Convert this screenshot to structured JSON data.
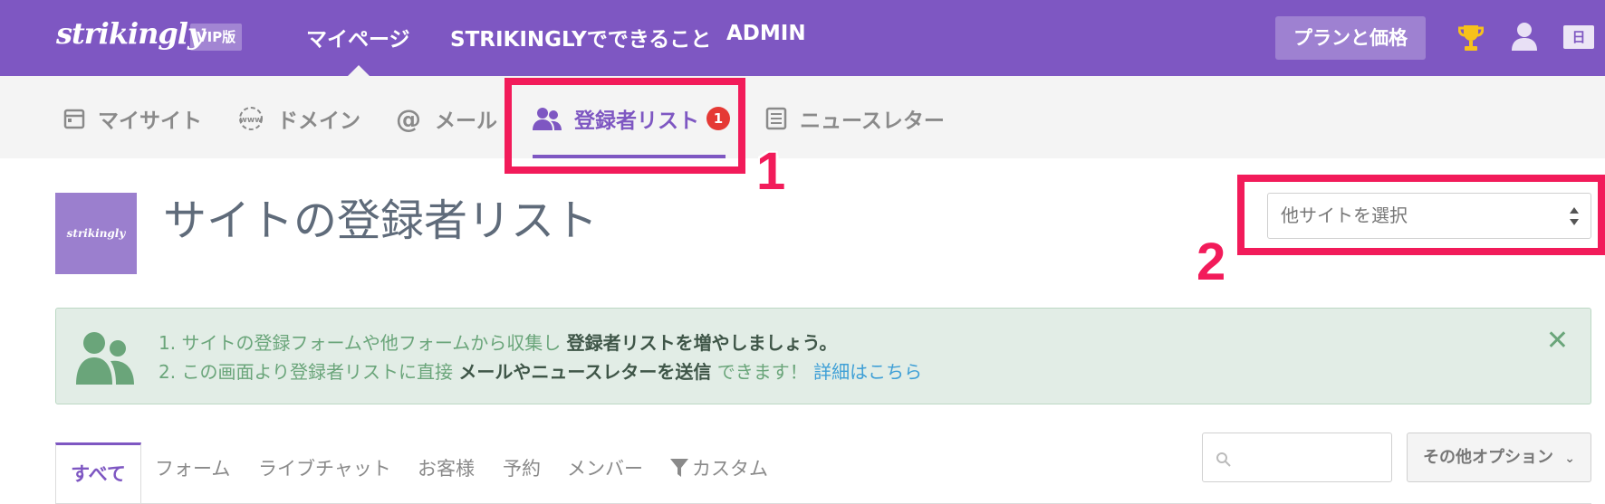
{
  "topbar": {
    "logo": "strikingly",
    "vip_badge": "VIP版",
    "nav": [
      {
        "label": "マイページ"
      },
      {
        "label": "STRIKINGLYでできること"
      },
      {
        "label": "ADMIN"
      }
    ],
    "plan_button": "プランと価格",
    "lang_button": "日"
  },
  "subnav": {
    "items": [
      {
        "label": "マイサイト",
        "icon": "calendar-icon"
      },
      {
        "label": "ドメイン",
        "icon": "www-icon"
      },
      {
        "label": "メール",
        "icon": "at-icon"
      },
      {
        "label": "登録者リスト",
        "icon": "users-icon",
        "badge": "1",
        "active": true
      },
      {
        "label": "ニュースレター",
        "icon": "newsletter-icon"
      }
    ]
  },
  "annotations": {
    "one": "1",
    "two": "2"
  },
  "header": {
    "thumb_text": "strikingly",
    "title": "サイトの登録者リスト",
    "site_select": "他サイトを選択"
  },
  "alert": {
    "line1_prefix": "1. サイトの登録フォームや他フォームから収集し ",
    "line1_bold": "登録者リストを増やしましょう。",
    "line2_prefix": "2. この画面より登録者リストに直接 ",
    "line2_bold": "メールやニュースレターを送信",
    "line2_suffix": " できます！ ",
    "line2_link": "詳細はこちら"
  },
  "tabs": [
    {
      "label": "すべて",
      "active": true
    },
    {
      "label": "フォーム"
    },
    {
      "label": "ライブチャット"
    },
    {
      "label": "お客様"
    },
    {
      "label": "予約"
    },
    {
      "label": "メンバー"
    },
    {
      "label": "カスタム"
    }
  ],
  "options_button": "その他オプション",
  "colors": {
    "brand": "#7e57c2",
    "annotation": "#f21b5a",
    "alert_bg": "#e2ede6"
  }
}
